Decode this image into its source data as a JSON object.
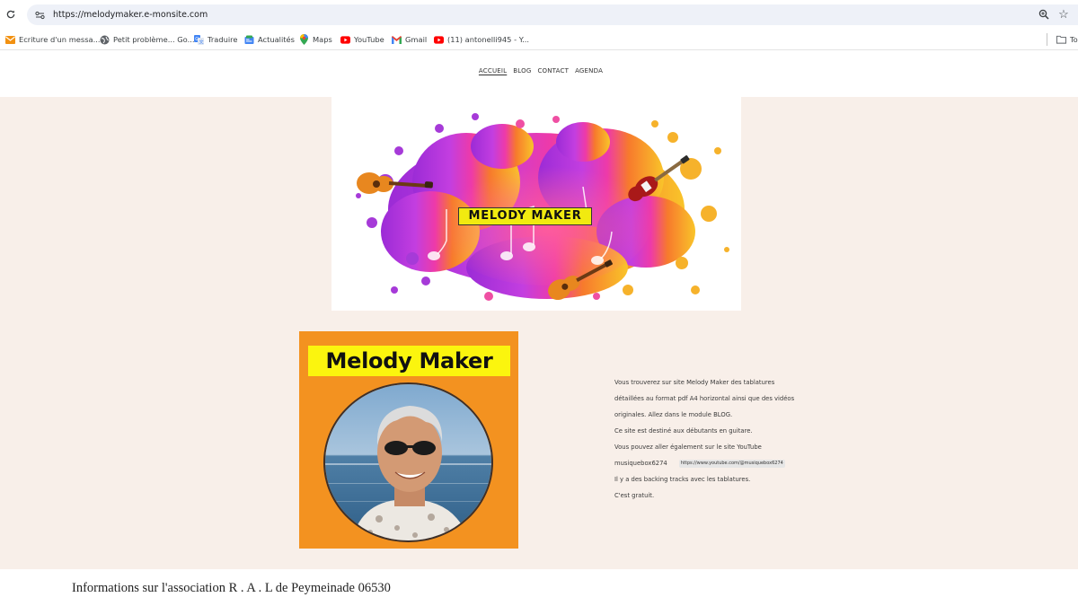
{
  "browser": {
    "url": "https://melodymaker.e-monsite.com",
    "bookmarks": [
      {
        "label": "Ecriture d'un messa...",
        "icon": "mail-icon"
      },
      {
        "label": "Petit problème... Go...",
        "icon": "globe-icon"
      },
      {
        "label": "Traduire",
        "icon": "translate-icon"
      },
      {
        "label": "Actualités",
        "icon": "news-icon"
      },
      {
        "label": "Maps",
        "icon": "maps-pin-icon"
      },
      {
        "label": "YouTube",
        "icon": "youtube-icon"
      },
      {
        "label": "Gmail",
        "icon": "gmail-icon"
      },
      {
        "label": "(11) antonelli945 - Y...",
        "icon": "youtube-icon"
      }
    ],
    "other_bookmarks_label": "To"
  },
  "nav": {
    "items": [
      {
        "label": "ACCUEIL",
        "active": true
      },
      {
        "label": "BLOG",
        "active": false
      },
      {
        "label": "CONTACT",
        "active": false
      },
      {
        "label": "AGENDA",
        "active": false
      }
    ]
  },
  "banner": {
    "title": "MELODY MAKER"
  },
  "profile": {
    "title": "Melody Maker"
  },
  "intro": {
    "lines": [
      "Vous trouverez sur site Melody Maker des tablatures",
      "détaillées au format pdf A4 horizontal ainsi que des vidéos",
      "originales. Allez dans le module BLOG.",
      "Ce site est destiné aux débutants en guitare.",
      "Vous pouvez aller également sur le site YouTube",
      "musiquebox6274",
      "Il y a des backing tracks avec les tablatures.",
      "C'est gratuit."
    ],
    "youtube_link": "https://www.youtube.com/@musiquebox6274"
  },
  "footer": {
    "info": "Informations sur l'association R . A . L de Peymeinade 06530"
  },
  "colors": {
    "page_background": "#f8efe9",
    "profile_orange": "#f39220",
    "title_yellow": "#fbf50e"
  }
}
